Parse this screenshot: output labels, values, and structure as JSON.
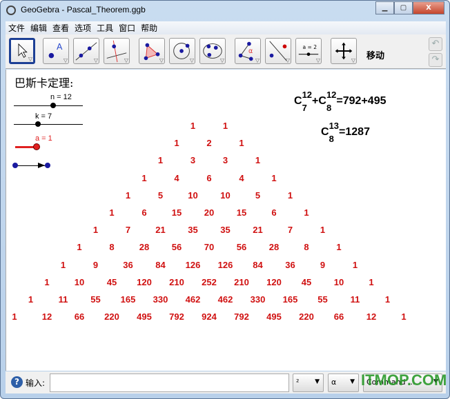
{
  "window": {
    "title": "GeoGebra - Pascal_Theorem.ggb",
    "minimize": "▁",
    "maximize": "▢",
    "close": "X"
  },
  "menu": [
    "文件",
    "编辑",
    "查看",
    "选项",
    "工具",
    "窗口",
    "帮助"
  ],
  "toolbar": {
    "tools": [
      "move",
      "point",
      "line-through-two-points",
      "perpendicular-line",
      "polygon",
      "circle-center-point",
      "conic-five-points",
      "angle",
      "reflect-about-line",
      "slider",
      "move-graphics-view"
    ],
    "selected_tool_label": "移动",
    "undo": "↶",
    "redo": "↷"
  },
  "canvas": {
    "heading": "巴斯卡定理:",
    "sliders": [
      {
        "label": "n = 12",
        "value": 12
      },
      {
        "label": "k = 7",
        "value": 7
      },
      {
        "label": "a = 1",
        "value": 1,
        "color": "#e02020"
      }
    ],
    "formula1": {
      "c1_top": "12",
      "c1_bottom": "7",
      "c2_top": "12",
      "c2_bottom": "8",
      "result": "=792+495"
    },
    "formula2": {
      "top": "13",
      "bottom": "8",
      "result": "=1287"
    },
    "pascal_color": "#d01010",
    "pascal_rows": [
      [
        1,
        1
      ],
      [
        1,
        2,
        1
      ],
      [
        1,
        3,
        3,
        1
      ],
      [
        1,
        4,
        6,
        4,
        1
      ],
      [
        1,
        5,
        10,
        10,
        5,
        1
      ],
      [
        1,
        6,
        15,
        20,
        15,
        6,
        1
      ],
      [
        1,
        7,
        21,
        35,
        35,
        21,
        7,
        1
      ],
      [
        1,
        8,
        28,
        56,
        70,
        56,
        28,
        8,
        1
      ],
      [
        1,
        9,
        36,
        84,
        126,
        126,
        84,
        36,
        9,
        1
      ],
      [
        1,
        10,
        45,
        120,
        210,
        252,
        210,
        120,
        45,
        10,
        1
      ],
      [
        1,
        11,
        55,
        165,
        330,
        462,
        462,
        330,
        165,
        55,
        11,
        1
      ],
      [
        1,
        12,
        66,
        220,
        495,
        792,
        924,
        792,
        495,
        220,
        66,
        12,
        1
      ]
    ]
  },
  "input": {
    "label": "输入:",
    "value": "",
    "symbols_dropdown": "²",
    "greek_dropdown": "α",
    "command_dropdown": "Command ..."
  },
  "watermark": "ITMOP.COM"
}
